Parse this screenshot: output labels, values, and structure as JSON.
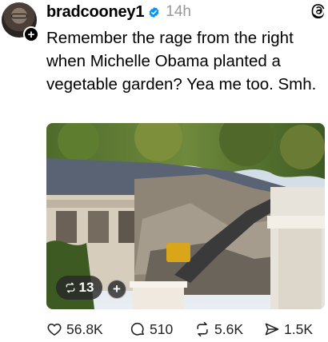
{
  "post": {
    "username": "bradcooney1",
    "timestamp": "14h",
    "text": "Remember the rage from the right when Michelle Obama planted a vegetable garden?  Yea me too. Smh.",
    "avatar_icon": "user-avatar",
    "follow_badge": "+",
    "verified_icon": "verified-badge-icon",
    "brand_icon": "threads-logo-icon"
  },
  "media": {
    "description_icon": "photo-demolition",
    "repost_count": "13",
    "plus_label": "+"
  },
  "actions": {
    "likes": "56.8K",
    "comments": "510",
    "reposts": "5.6K",
    "shares": "1.5K"
  },
  "colors": {
    "verified": "#0095f6",
    "muted": "#999999",
    "text": "#000000"
  }
}
